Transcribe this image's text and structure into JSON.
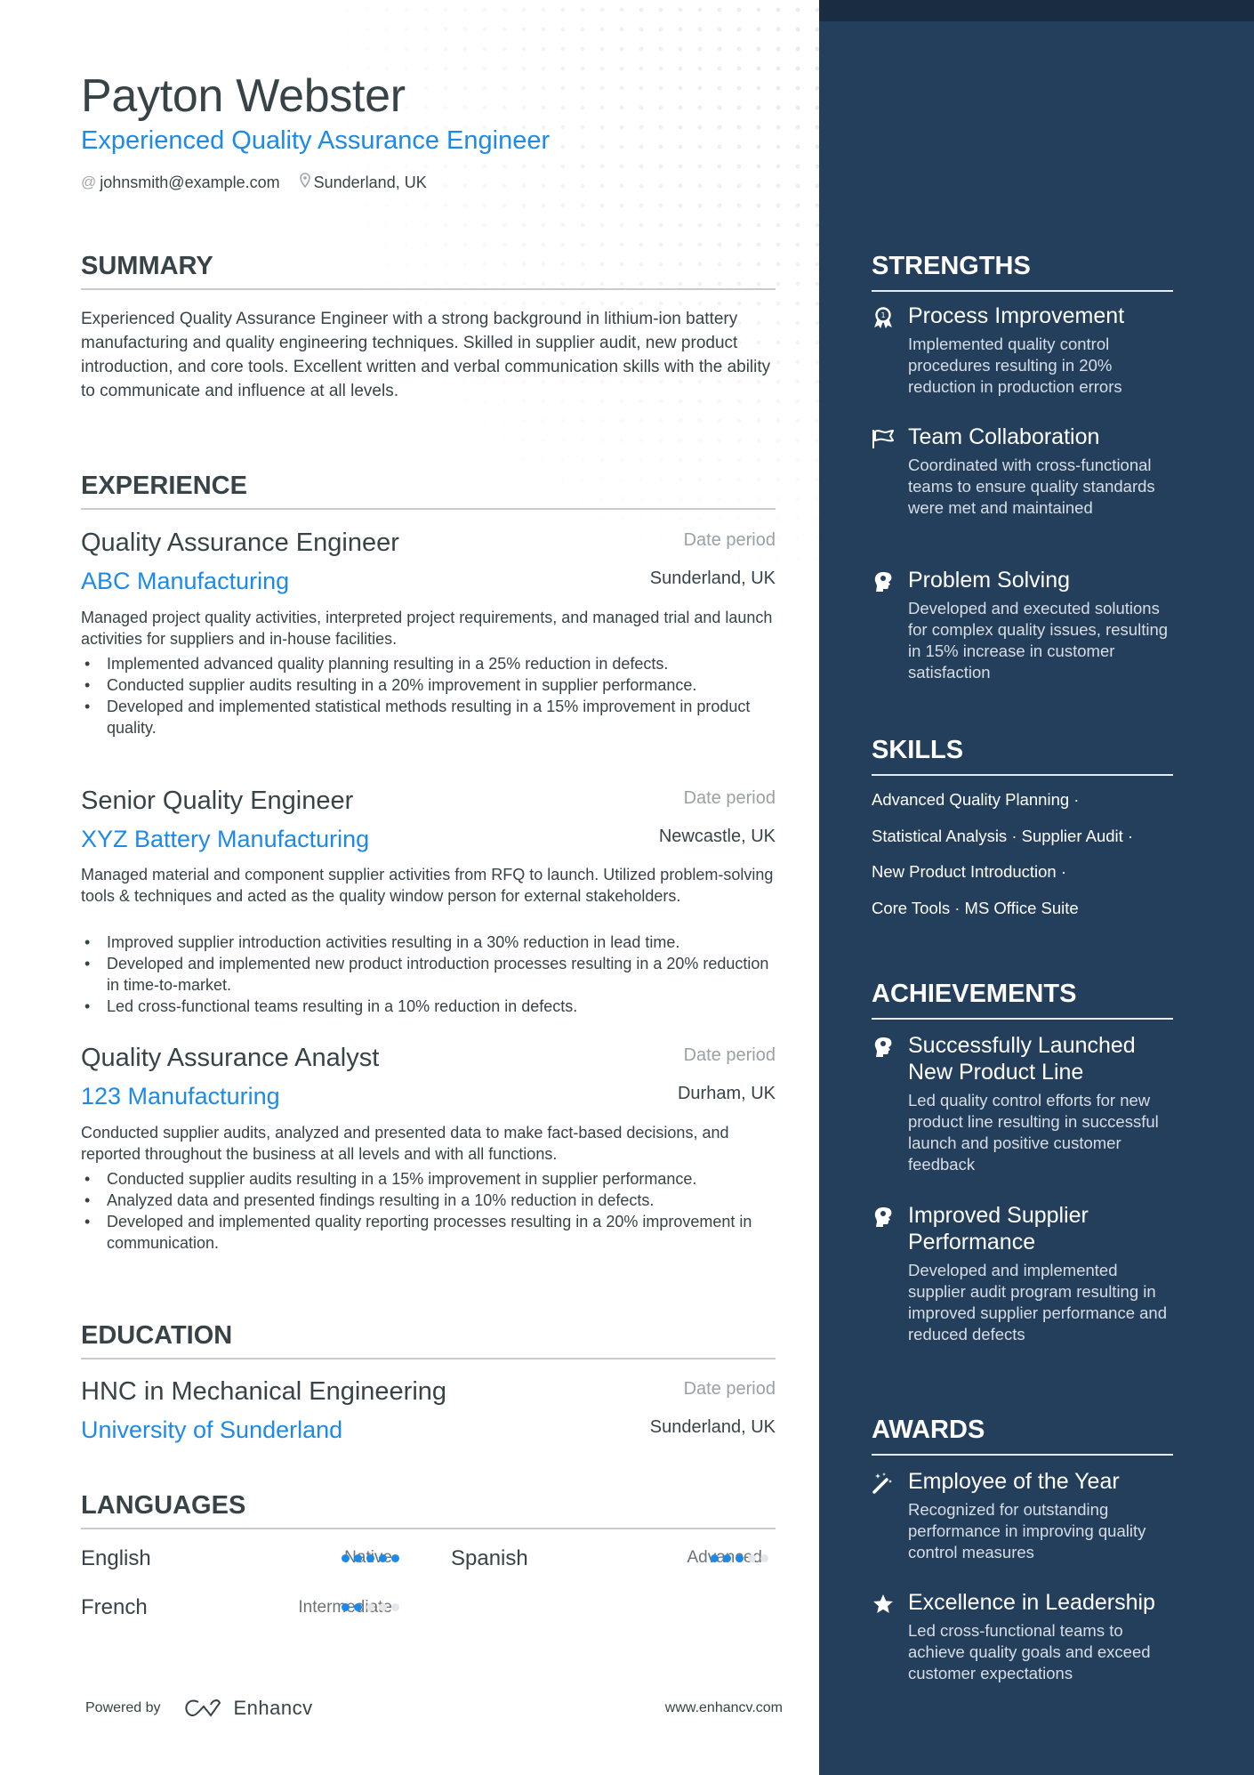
{
  "header": {
    "name": "Payton Webster",
    "headline": "Experienced Quality Assurance Engineer",
    "email": "johnsmith@example.com",
    "location": "Sunderland, UK",
    "email_icon": "at-icon",
    "location_icon": "map-pin-icon"
  },
  "summary": {
    "title": "SUMMARY",
    "text": "Experienced Quality Assurance Engineer with a strong background in lithium-ion battery manufacturing and quality engineering techniques. Skilled in supplier audit, new product introduction, and core tools. Excellent written and verbal communication skills with the ability to communicate and influence at all levels."
  },
  "experience": {
    "title": "EXPERIENCE",
    "jobs": [
      {
        "title": "Quality Assurance Engineer",
        "company": "ABC Manufacturing",
        "date": "Date period",
        "location": "Sunderland, UK",
        "description": "Managed project quality activities, interpreted project requirements, and managed trial and launch activities for suppliers and in-house facilities.",
        "bullets": [
          "Implemented advanced quality planning resulting in a 25% reduction in defects.",
          "Conducted supplier audits resulting in a 20% improvement in supplier performance.",
          "Developed and implemented statistical methods resulting in a 15% improvement in product quality."
        ]
      },
      {
        "title": "Senior Quality Engineer",
        "company": "XYZ Battery Manufacturing",
        "date": "Date period",
        "location": "Newcastle, UK",
        "description": "Managed material and component supplier activities from RFQ to launch. Utilized problem-solving tools & techniques and acted as the quality window person for external stakeholders.",
        "bullets": [
          "Improved supplier introduction activities resulting in a 30% reduction in lead time.",
          "Developed and implemented new product introduction processes resulting in a 20% reduction in time-to-market.",
          "Led cross-functional teams resulting in a 10% reduction in defects."
        ]
      },
      {
        "title": "Quality Assurance Analyst",
        "company": "123 Manufacturing",
        "date": "Date period",
        "location": "Durham, UK",
        "description": "Conducted supplier audits, analyzed and presented data to make fact-based decisions, and reported throughout the business at all levels and with all functions.",
        "bullets": [
          "Conducted supplier audits resulting in a 15% improvement in supplier performance.",
          "Analyzed data and presented findings resulting in a 10% reduction in defects.",
          "Developed and implemented quality reporting processes resulting in a 20% improvement in communication."
        ]
      }
    ]
  },
  "education": {
    "title": "EDUCATION",
    "degree": "HNC in Mechanical Engineering",
    "school": "University of Sunderland",
    "date": "Date period",
    "location": "Sunderland, UK"
  },
  "languages": {
    "title": "LANGUAGES",
    "items": [
      {
        "name": "English",
        "level": "Native",
        "rating": 5,
        "max": 5
      },
      {
        "name": "Spanish",
        "level": "Advanced",
        "rating": 3,
        "max": 5
      },
      {
        "name": "French",
        "level": "Intermediate",
        "rating": 2,
        "max": 5
      }
    ]
  },
  "footer": {
    "powered_by": "Powered by",
    "brand": "Enhancv",
    "website": "www.enhancv.com"
  },
  "strengths": {
    "title": "STRENGTHS",
    "items": [
      {
        "icon": "award-medal-icon",
        "title": "Process Improvement",
        "desc": "Implemented quality control procedures resulting in 20% reduction in production errors"
      },
      {
        "icon": "flag-icon",
        "title": "Team Collaboration",
        "desc": "Coordinated with cross-functional teams to ensure quality standards were met and maintained"
      },
      {
        "icon": "head-brain-icon",
        "title": "Problem Solving",
        "desc": "Developed and executed solutions for complex quality issues, resulting in 15% increase in customer satisfaction"
      }
    ]
  },
  "skills": {
    "title": "SKILLS",
    "lines": [
      "Advanced Quality Planning ·",
      "Statistical Analysis · Supplier Audit ·",
      "New Product Introduction ·",
      "Core Tools · MS Office Suite"
    ]
  },
  "achievements": {
    "title": "ACHIEVEMENTS",
    "items": [
      {
        "icon": "head-brain-icon",
        "title": "Successfully Launched New Product Line",
        "desc": "Led quality control efforts for new product line resulting in successful launch and positive customer feedback"
      },
      {
        "icon": "head-brain-icon",
        "title": "Improved Supplier Performance",
        "desc": "Developed and implemented supplier audit program resulting in improved supplier performance and reduced defects"
      }
    ]
  },
  "awards": {
    "title": "AWARDS",
    "items": [
      {
        "icon": "magic-wand-icon",
        "title": "Employee of the Year",
        "desc": "Recognized for outstanding performance in improving quality control measures"
      },
      {
        "icon": "star-icon",
        "title": "Excellence in Leadership",
        "desc": "Led cross-functional teams to achieve quality goals and exceed customer expectations"
      }
    ]
  },
  "colors": {
    "accent": "#1d8ae8",
    "sidebar": "#243f5c",
    "sidebar_strip": "#1a2c42",
    "text": "#384347",
    "muted": "#9aa1a6"
  }
}
